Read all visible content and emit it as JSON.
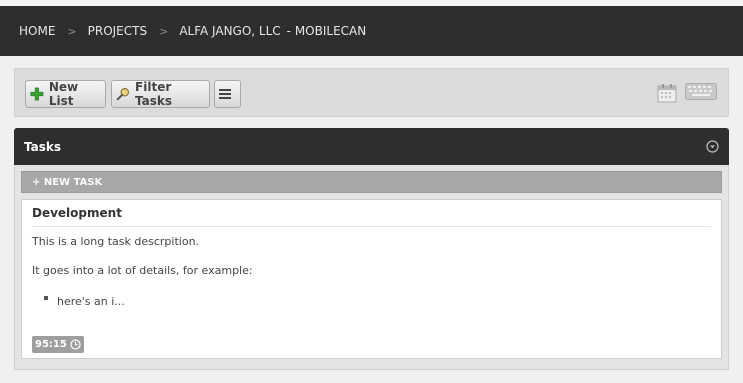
{
  "breadcrumb": {
    "home": "HOME",
    "projects": "PROJECTS",
    "client": "ALFA JANGO, LLC",
    "project": "- MOBILECAN"
  },
  "toolbar": {
    "new_list_label": "New List",
    "filter_tasks_label": "Filter Tasks",
    "icons": [
      "plus-icon",
      "magnifier-icon",
      "hamburger-menu-icon",
      "calendar-icon",
      "keyboard-icon"
    ]
  },
  "tasks_panel": {
    "title": "Tasks",
    "new_task_label": "+ NEW TASK",
    "task": {
      "title": "Development",
      "paragraph_1": "This is a long task descrpition.",
      "paragraph_2": "It goes into a lot of details, for example:",
      "list_item": "here's an i...",
      "time": "95:15"
    }
  },
  "colors": {
    "header_bg": "#2e2e2e",
    "toolbar_bg": "#dcdcdc",
    "new_task_bar": "#a8a8a8",
    "badge_bg": "#9e9e9e",
    "plus_green": "#3aa333"
  }
}
